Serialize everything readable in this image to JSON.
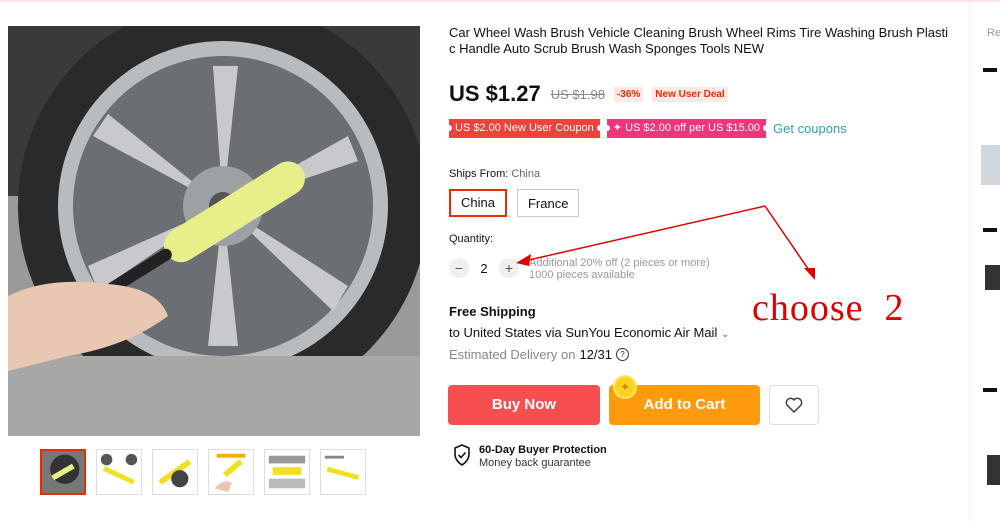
{
  "product": {
    "title": "Car Wheel Wash Brush Vehicle Cleaning Brush Wheel Rims Tire Washing Brush Plastic Handle Auto Scrub Brush Wash Sponges Tools NEW"
  },
  "price": {
    "current": "US $1.27",
    "original": "US $1.98",
    "discount": "-36%",
    "deal_badge": "New User Deal"
  },
  "coupons": {
    "items": [
      "US $2.00 New User Coupon",
      "✦ US $2.00 off per US $15.00"
    ],
    "link": "Get coupons"
  },
  "ships_from": {
    "label": "Ships From:",
    "value": "China",
    "options": [
      "China",
      "France"
    ]
  },
  "quantity": {
    "label": "Quantity:",
    "value": "2",
    "minus": "−",
    "plus": "+",
    "offer": "Additional 20% off (2 pieces or more)",
    "available": "1000 pieces available"
  },
  "shipping": {
    "title": "Free Shipping",
    "destination": "to United States via SunYou Economic Air Mail",
    "chevron": "⌄",
    "delivery_label": "Estimated Delivery on",
    "delivery_date": "12/31",
    "help": "?"
  },
  "actions": {
    "buy_now": "Buy Now",
    "add_to_cart": "Add to Cart",
    "wishlist_icon": "heart-icon"
  },
  "protection": {
    "title": "60-Day Buyer Protection",
    "subtitle": "Money back guarantee"
  },
  "annotation": {
    "text": "choose  2"
  },
  "recommendations": {
    "label": "Re"
  },
  "colors": {
    "buy_now": "#f74f4f",
    "add_to_cart": "#ff9a0c",
    "accent_red": "#e62e04",
    "link_blue": "#2e9cc3",
    "annotation_red": "#e00000"
  }
}
